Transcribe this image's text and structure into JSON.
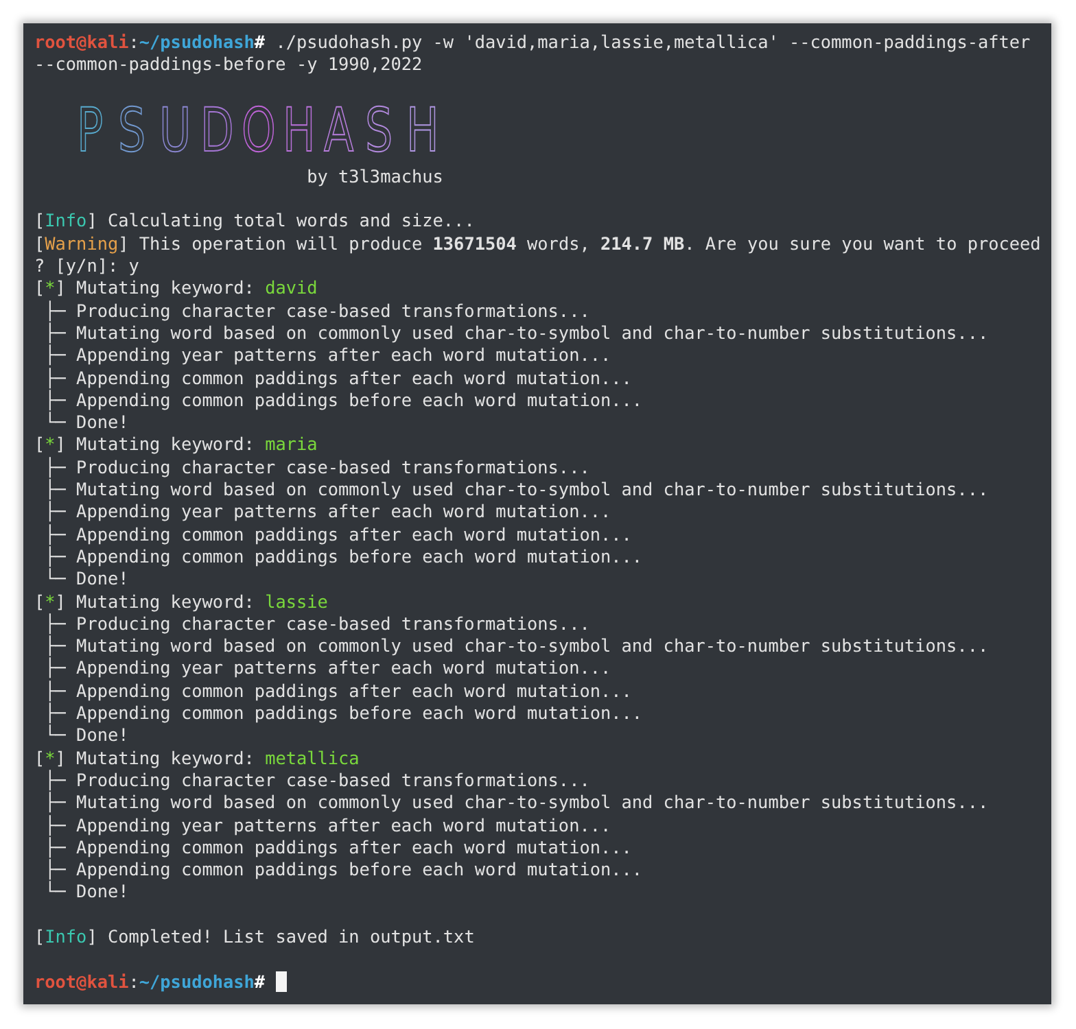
{
  "terminal": {
    "command_prompt": {
      "user": "root@kali",
      "sep": ":",
      "path": "~/psudohash",
      "symbol": "#",
      "command": " ./psudohash.py -w 'david,maria,lassie,metallica' --common-paddings-after\n--common-paddings-before -y 1990,2022"
    },
    "banner": {
      "title": "PSUDOHASH",
      "byline": "by t3l3machus"
    },
    "messages": [
      {
        "kind": "info",
        "tag": {
          "open": "[",
          "label": "Info",
          "close": "]"
        },
        "text": " Calculating total words and size..."
      },
      {
        "kind": "warning",
        "tag": {
          "open": "[",
          "label": "Warning",
          "close": "]"
        },
        "text": " This operation will produce **13671504** words, **214.7 MB**. Are you sure you want to proceed\n? [y/n]: y"
      }
    ],
    "keywords": [
      {
        "tag": {
          "open": "[",
          "label": "*",
          "close": "]"
        },
        "label": " Mutating keyword: ",
        "keyword": "david",
        "steps": [
          " ├─ Producing character case-based transformations...",
          " ├─ Mutating word based on commonly used char-to-symbol and char-to-number substitutions...",
          " ├─ Appending year patterns after each word mutation...",
          " ├─ Appending common paddings after each word mutation...",
          " ├─ Appending common paddings before each word mutation...",
          " └─ Done!"
        ]
      },
      {
        "tag": {
          "open": "[",
          "label": "*",
          "close": "]"
        },
        "label": " Mutating keyword: ",
        "keyword": "maria",
        "steps": [
          " ├─ Producing character case-based transformations...",
          " ├─ Mutating word based on commonly used char-to-symbol and char-to-number substitutions...",
          " ├─ Appending year patterns after each word mutation...",
          " ├─ Appending common paddings after each word mutation...",
          " ├─ Appending common paddings before each word mutation...",
          " └─ Done!"
        ]
      },
      {
        "tag": {
          "open": "[",
          "label": "*",
          "close": "]"
        },
        "label": " Mutating keyword: ",
        "keyword": "lassie",
        "steps": [
          " ├─ Producing character case-based transformations...",
          " ├─ Mutating word based on commonly used char-to-symbol and char-to-number substitutions...",
          " ├─ Appending year patterns after each word mutation...",
          " ├─ Appending common paddings after each word mutation...",
          " ├─ Appending common paddings before each word mutation...",
          " └─ Done!"
        ]
      },
      {
        "tag": {
          "open": "[",
          "label": "*",
          "close": "]"
        },
        "label": " Mutating keyword: ",
        "keyword": "metallica",
        "steps": [
          " ├─ Producing character case-based transformations...",
          " ├─ Mutating word based on commonly used char-to-symbol and char-to-number substitutions...",
          " ├─ Appending year patterns after each word mutation...",
          " ├─ Appending common paddings after each word mutation...",
          " ├─ Appending common paddings before each word mutation...",
          " └─ Done!"
        ]
      }
    ],
    "result": {
      "kind": "info",
      "tag": {
        "open": "[",
        "label": "Info",
        "close": "]"
      },
      "text": " Completed! List saved in output.txt"
    },
    "final_prompt": {
      "user": "root@kali",
      "sep": ":",
      "path": "~/psudohash",
      "symbol": "#"
    }
  }
}
